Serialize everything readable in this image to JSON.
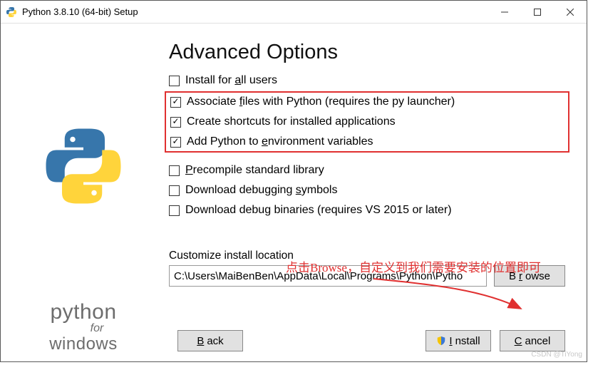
{
  "titlebar": {
    "title": "Python 3.8.10 (64-bit) Setup"
  },
  "heading": "Advanced Options",
  "options": [
    {
      "checked": false,
      "pre": "Install for ",
      "u": "a",
      "post": "ll users"
    },
    {
      "checked": true,
      "pre": "Associate ",
      "u": "f",
      "post": "iles with Python (requires the py launcher)"
    },
    {
      "checked": true,
      "pre": "Create shortcuts for installed applications",
      "u": "",
      "post": ""
    },
    {
      "checked": true,
      "pre": "Add Python to ",
      "u": "e",
      "post": "nvironment variables"
    },
    {
      "checked": false,
      "pre": "",
      "u": "P",
      "post": "recompile standard library"
    },
    {
      "checked": false,
      "pre": "Download debugging ",
      "u": "s",
      "post": "ymbols"
    },
    {
      "checked": false,
      "pre": "Download debu",
      "u": "g",
      "post": " binaries (requires VS 2015 or later)"
    }
  ],
  "location": {
    "label": "Customize install location",
    "value": "C:\\Users\\MaiBenBen\\AppData\\Local\\Programs\\Python\\Pytho",
    "browse_pre": "B",
    "browse_u": "r",
    "browse_post": "owse"
  },
  "buttons": {
    "back_u": "B",
    "back_post": "ack",
    "install_u": "I",
    "install_post": "nstall",
    "cancel_u": "C",
    "cancel_post": "ancel"
  },
  "brand": {
    "l1": "python",
    "l2": "for",
    "l3": "windows"
  },
  "annotation": "点击Browse，自定义到我们需要安装的位置即可",
  "watermark": "CSDN @TiYong"
}
